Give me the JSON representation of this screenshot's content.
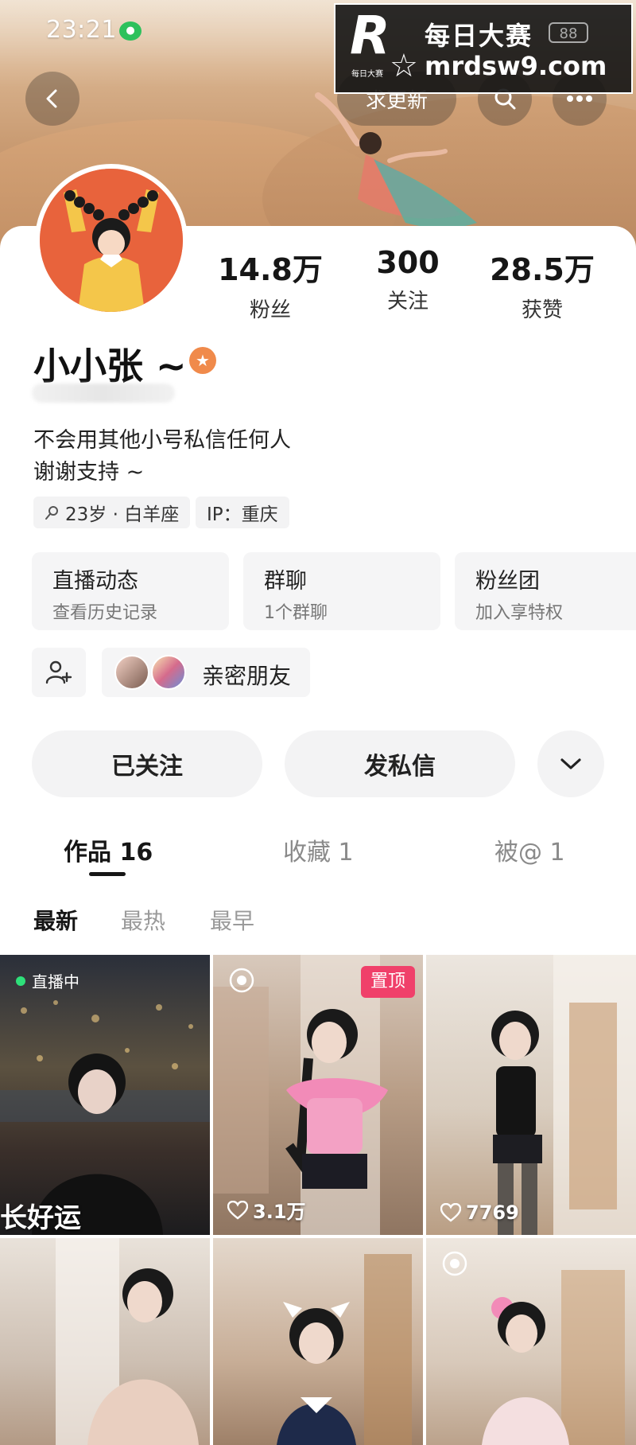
{
  "status_bar": {
    "time": "23:21"
  },
  "watermark": {
    "logo_letter": "R",
    "logo_small": "每日大赛",
    "brand": "每日大赛",
    "badge": "88",
    "url": "mrdsw9.com"
  },
  "header": {
    "update_label": "求更新"
  },
  "profile": {
    "name": "小小张 ~",
    "stats": [
      {
        "value": "14.8万",
        "label": "粉丝"
      },
      {
        "value": "300",
        "label": "关注"
      },
      {
        "value": "28.5万",
        "label": "获赞"
      }
    ],
    "bio_lines": [
      "不会用其他小号私信任何人",
      "谢谢支持 ~"
    ],
    "tags": [
      "23岁 · 白羊座",
      "IP：重庆"
    ]
  },
  "features": [
    {
      "title": "直播动态",
      "subtitle": "查看历史记录"
    },
    {
      "title": "群聊",
      "subtitle": "1个群聊"
    },
    {
      "title": "粉丝团",
      "subtitle": "加入享特权"
    }
  ],
  "friends": {
    "label": "亲密朋友"
  },
  "actions": {
    "followed": "已关注",
    "message": "发私信"
  },
  "tabs": [
    {
      "label": "作品 16"
    },
    {
      "label": "收藏 1"
    },
    {
      "label": "被@ 1"
    }
  ],
  "sort": [
    "最新",
    "最热",
    "最早"
  ],
  "videos": [
    {
      "live": "直播中",
      "overlay": "长好运"
    },
    {
      "pin": "置顶",
      "likes": "3.1万"
    },
    {
      "likes": "7769"
    },
    {},
    {},
    {}
  ],
  "colors": {
    "accent_pin": "#f0406a",
    "live_dot": "#2ee07a",
    "avatar_bg": "#e8633c"
  }
}
